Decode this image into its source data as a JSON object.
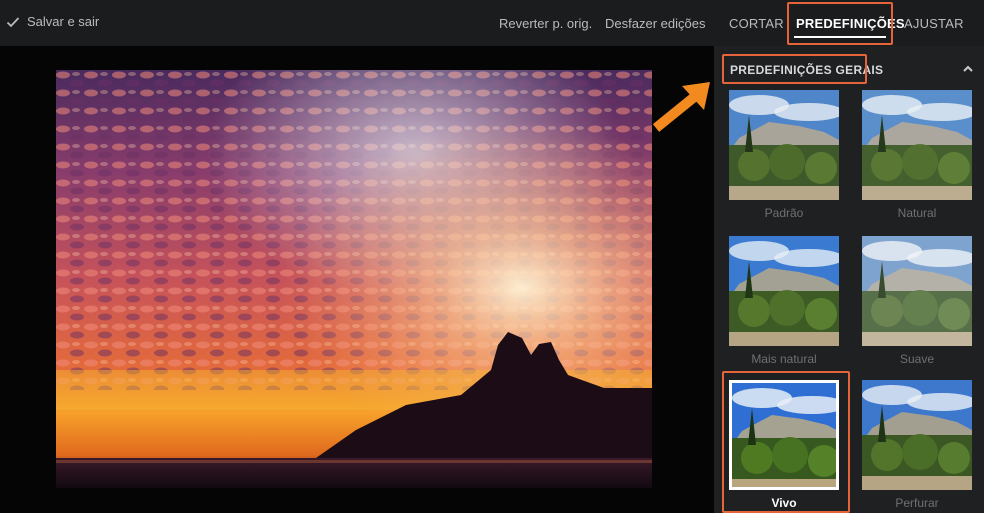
{
  "toolbar": {
    "save_exit_label": "Salvar e sair",
    "revert_label": "Reverter p. orig.",
    "undo_label": "Desfazer edições"
  },
  "tabs": [
    {
      "label": "CORTAR"
    },
    {
      "label": "PREDEFINIÇÕES",
      "active": true
    },
    {
      "label": "AJUSTAR"
    }
  ],
  "section": {
    "title": "PREDEFINIÇÕES GERAIS"
  },
  "presets": [
    {
      "label": "Padrão"
    },
    {
      "label": "Natural"
    },
    {
      "label": "Mais natural"
    },
    {
      "label": "Suave"
    },
    {
      "label": "Vivo",
      "selected": true
    },
    {
      "label": "Perfurar"
    }
  ],
  "colors": {
    "highlight": "#e5643a",
    "arrow": "#f28a1f",
    "panel_bg": "#1f2021",
    "topbar_bg": "#1b1c1d"
  }
}
